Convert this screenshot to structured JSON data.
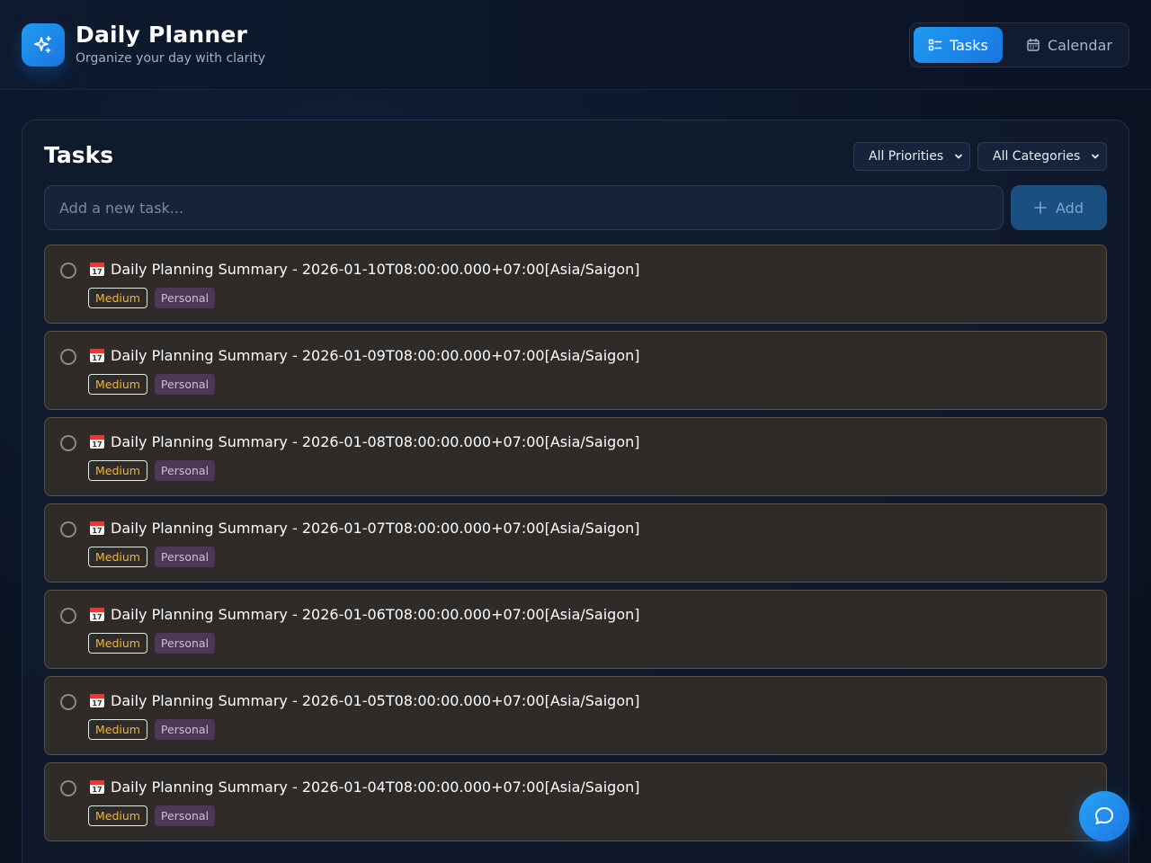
{
  "header": {
    "title": "Daily Planner",
    "subtitle": "Organize your day with clarity",
    "logo_icon": "sparkles-icon",
    "views": [
      {
        "label": "Tasks",
        "icon": "list-checks-icon",
        "active": true
      },
      {
        "label": "Calendar",
        "icon": "calendar-icon",
        "active": false
      }
    ]
  },
  "tasks_panel": {
    "title": "Tasks",
    "filters": {
      "priority": "All Priorities",
      "category": "All Categories"
    },
    "new_task": {
      "placeholder": "Add a new task...",
      "value": ""
    },
    "add_label": "Add",
    "tasks": [
      {
        "icon": "📅",
        "title": "Daily Planning Summary - 2026-01-10T08:00:00.000+07:00[Asia/Saigon]",
        "priority": "Medium",
        "category": "Personal",
        "done": false
      },
      {
        "icon": "📅",
        "title": "Daily Planning Summary - 2026-01-09T08:00:00.000+07:00[Asia/Saigon]",
        "priority": "Medium",
        "category": "Personal",
        "done": false
      },
      {
        "icon": "📅",
        "title": "Daily Planning Summary - 2026-01-08T08:00:00.000+07:00[Asia/Saigon]",
        "priority": "Medium",
        "category": "Personal",
        "done": false
      },
      {
        "icon": "📅",
        "title": "Daily Planning Summary - 2026-01-07T08:00:00.000+07:00[Asia/Saigon]",
        "priority": "Medium",
        "category": "Personal",
        "done": false
      },
      {
        "icon": "📅",
        "title": "Daily Planning Summary - 2026-01-06T08:00:00.000+07:00[Asia/Saigon]",
        "priority": "Medium",
        "category": "Personal",
        "done": false
      },
      {
        "icon": "📅",
        "title": "Daily Planning Summary - 2026-01-05T08:00:00.000+07:00[Asia/Saigon]",
        "priority": "Medium",
        "category": "Personal",
        "done": false
      },
      {
        "icon": "📅",
        "title": "Daily Planning Summary - 2026-01-04T08:00:00.000+07:00[Asia/Saigon]",
        "priority": "Medium",
        "category": "Personal",
        "done": false
      }
    ]
  },
  "chat_button": {
    "icon": "chat-bubble-icon"
  },
  "colors": {
    "accent": "#1e9bf0",
    "priority_medium": "#f2b630",
    "category_personal_bg": "#4b3956",
    "task_card_bg": "#2e2b29"
  }
}
